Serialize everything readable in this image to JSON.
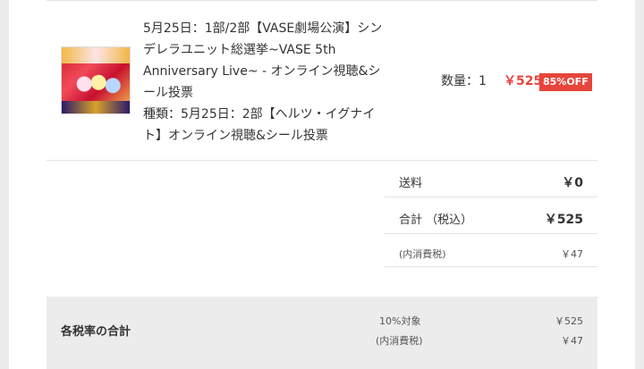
{
  "cart_item": {
    "title": "5月25日：1部/2部【VASE劇場公演】シンデレラユニット総選挙~VASE 5th Anniversary Live~ - オンライン視聴&シール投票",
    "variant": "種類：5月25日：2部【ヘルツ・イグナイト】オンライン視聴&シール投票",
    "quantity_label": "数量：1",
    "price": "￥525",
    "discount_badge": "85%OFF"
  },
  "summary": {
    "shipping_label": "送料",
    "shipping_value": "￥0",
    "total_label": "合計 （税込）",
    "total_value": "￥525",
    "tax_label": "(内消費税)",
    "tax_value": "￥47"
  },
  "tax_rate_totals": {
    "title": "各税率の合計",
    "rate_label": "10%対象",
    "rate_value": "￥525",
    "tax_label": "(内消費税)",
    "tax_value": "￥47"
  },
  "colors": {
    "accent_red": "#e6453c",
    "panel_gray": "#ececec"
  }
}
